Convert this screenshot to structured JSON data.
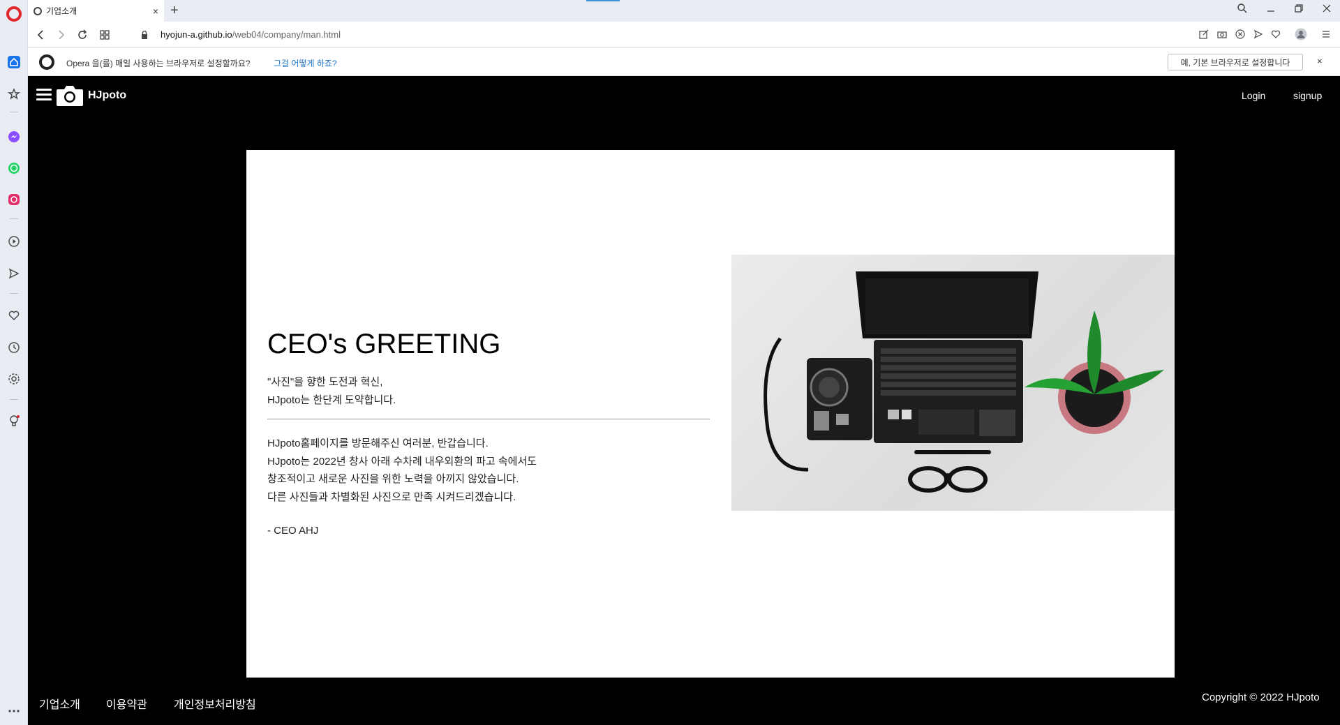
{
  "browser": {
    "tab": {
      "title": "기업소개",
      "close": "×"
    },
    "new_tab": "+",
    "url_host": "hyojun-a.github.io",
    "url_path": "/web04/company/man.html",
    "infobar": {
      "text": "Opera 을(를) 매일 사용하는 브라우저로 설정할까요?",
      "link": "그걸 어떻게 하죠?",
      "button": "예, 기본 브라우저로 설정합니다",
      "close": "×"
    },
    "accent": "#3f8fd8",
    "brand_red": "#e0252b"
  },
  "site": {
    "brand": "HJpoto",
    "nav": {
      "login": "Login",
      "signup": "signup"
    },
    "greeting": {
      "title": "CEO's GREETING",
      "subtitle": [
        "\"사진\"을 향한 도전과 혁신,",
        "HJpoto는 한단계 도약합니다."
      ],
      "body": [
        "HJpoto홈페이지를 방문해주신 여러분, 반갑습니다.",
        "HJpoto는 2022년 창사 아래 수차례 내우외환의 파고 속에서도",
        "창조적이고 새로운 사진을 위한 노력을 아끼지 않았습니다.",
        "다른 사진들과 차별화된 사진으로 만족 시켜드리겠습니다."
      ],
      "signature": "- CEO AHJ"
    },
    "footer": {
      "links": [
        "기업소개",
        "이용약관",
        "개인정보처리방침"
      ],
      "copyright": "Copyright © 2022 HJpoto"
    }
  }
}
